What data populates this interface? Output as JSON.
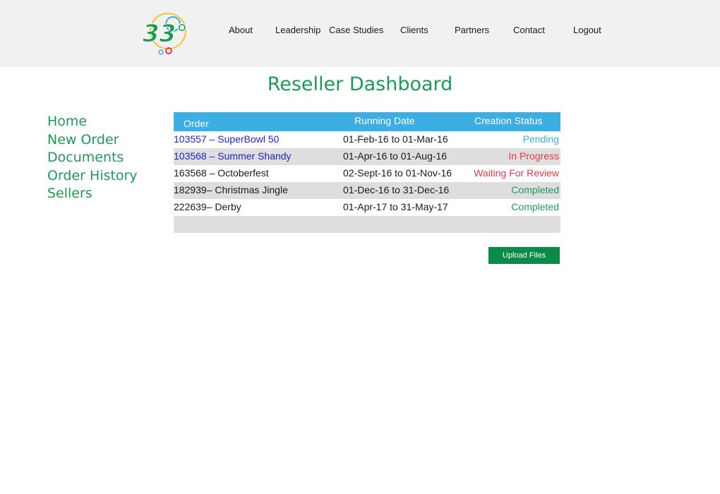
{
  "header": {
    "logo_text": "33°",
    "nav": [
      {
        "label": "About"
      },
      {
        "label": "Leadership"
      },
      {
        "label": "Case Studies"
      },
      {
        "label": "Clients"
      },
      {
        "label": "Partners"
      },
      {
        "label": "Contact"
      },
      {
        "label": "Logout"
      }
    ]
  },
  "page": {
    "title": "Reseller Dashboard"
  },
  "sidebar": {
    "items": [
      {
        "label": "Home"
      },
      {
        "label": "New Order"
      },
      {
        "label": "Documents"
      },
      {
        "label": "Order History"
      },
      {
        "label": "Sellers"
      }
    ]
  },
  "table": {
    "columns": {
      "order": "Order",
      "running_date": "Running Date",
      "status": "Creation Status"
    },
    "rows": [
      {
        "order": "103557 – SuperBowl 50",
        "date": "01-Feb-16 to 01-Mar-16",
        "status": "Pending"
      },
      {
        "order": "103568 – Summer Shandy",
        "date": "01-Apr-16 to 01-Aug-16",
        "status": "In Progress"
      },
      {
        "order": "163568 – Octoberfest",
        "date": "02-Sept-16 to 01-Nov-16",
        "status": "Waiting For Review"
      },
      {
        "order": "182939– Christmas Jingle",
        "date": "01-Dec-16 to 31-Dec-16",
        "status": "Completed"
      },
      {
        "order": "222639– Derby",
        "date": "01-Apr-17 to 31-May-17",
        "status": "Completed"
      }
    ]
  },
  "actions": {
    "upload_label": "Upload Files"
  },
  "colors": {
    "brand_green": "#1e9a57",
    "button_green": "#0c8a48",
    "table_header": "#3daee3",
    "row_shade": "#dedede",
    "link_blue": "#2222cc",
    "status_pending": "#3daee3",
    "status_in_progress": "#e8384f",
    "status_waiting": "#e8384f",
    "status_completed": "#1e9a57"
  }
}
